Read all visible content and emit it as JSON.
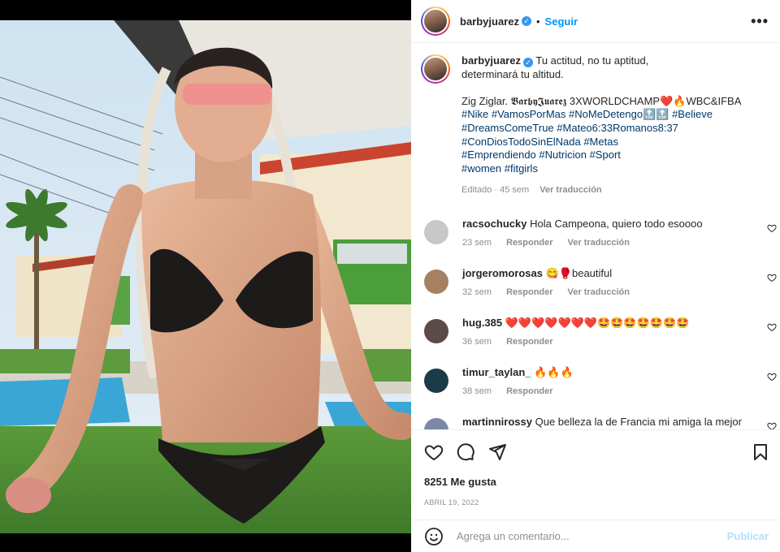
{
  "header": {
    "username": "barbyjuarez",
    "verified": true,
    "separator": "•",
    "follow_label": "Seguir",
    "more_label": "•••"
  },
  "caption": {
    "username": "barbyjuarez",
    "line1": "Tu actitud, no tu aptitud,",
    "line2": "determinará tu altitud.",
    "line3_a": "Zig Ziglar. ",
    "line3_b": "𝕭𝖆𝖗𝖇𝖞𝕵𝖚𝖆𝖗𝖊𝖟",
    "line3_c": " 3XWORLDCHAMP❤️🔥WBC&IFBA",
    "tags": [
      [
        "#Nike",
        "#VamosPorMas",
        "#NoMeDetengo🔝🔝",
        "#Believe"
      ],
      [
        "#DreamsComeTrue",
        "#Mateo6:33Romanos8:37"
      ],
      [
        "#ConDiosTodoSinElNada",
        "#Metas"
      ],
      [
        "#Emprendiendo",
        "#Nutricion",
        "#Sport"
      ],
      [
        "#women",
        "#fitgirls"
      ]
    ],
    "edited": "Editado · 45 sem",
    "translate": "Ver traducción"
  },
  "comments": [
    {
      "user": "racsochucky",
      "text": "Hola Campeona, quiero todo esoooo",
      "age": "23 sem",
      "reply": "Responder",
      "translate": "Ver traducción",
      "color": "#c8c8c8"
    },
    {
      "user": "jorgeromorosas",
      "text": "😋🥊beautiful",
      "age": "32 sem",
      "reply": "Responder",
      "translate": "Ver traducción",
      "color": "#a58162"
    },
    {
      "user": "hug.385",
      "text": "❤️❤️❤️❤️❤️❤️❤️🤩🤩🤩🤩🤩🤩🤩",
      "age": "36 sem",
      "reply": "Responder",
      "translate": "",
      "color": "#5c4a48"
    },
    {
      "user": "timur_taylan_",
      "text": "🔥🔥🔥",
      "age": "38 sem",
      "reply": "Responder",
      "translate": "",
      "color": "#1b3b48"
    },
    {
      "user": "martinnirossy",
      "text": "Que belleza la de Francia mi amiga la mejor en de México y el mundo entero",
      "age": "",
      "reply": "",
      "translate": "",
      "color": "#7a8aa6"
    }
  ],
  "actions": {
    "likes": "8251 Me gusta",
    "date": "ABRIL 19, 2022"
  },
  "composer": {
    "placeholder": "Agrega un comentario...",
    "post_label": "Publicar"
  },
  "colors": {
    "link_blue": "#0095f6",
    "hashtag": "#00376b",
    "muted": "#8e8e8e"
  }
}
